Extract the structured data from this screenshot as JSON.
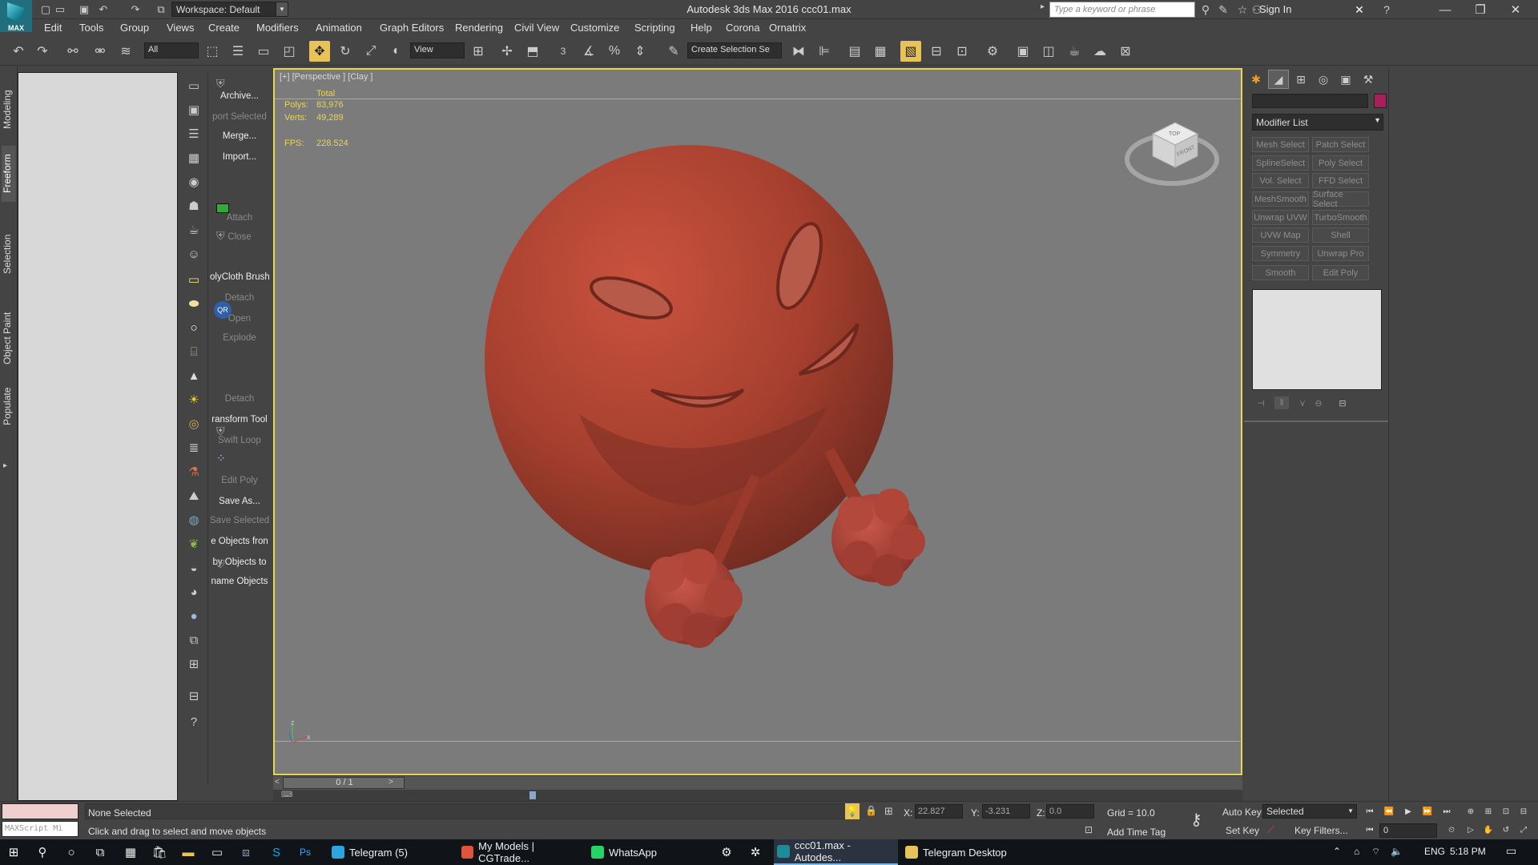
{
  "app": {
    "logo_text": "MAX",
    "title": "Autodesk 3ds Max 2016      ccc01.max",
    "workspace": "Workspace: Default",
    "search_placeholder": "Type a keyword or phrase",
    "signin": "Sign In"
  },
  "menu": [
    "Edit",
    "Tools",
    "Group",
    "Views",
    "Create",
    "Modifiers",
    "Animation",
    "Graph Editors",
    "Rendering",
    "Civil View",
    "Customize",
    "Scripting",
    "Help",
    "Corona",
    "Ornatrix"
  ],
  "toolbar": {
    "filter_select": "All",
    "ref_coord": "View",
    "selection_set": "Create Selection Se",
    "snap_label": "3"
  },
  "ribbon_tabs": [
    "Modeling",
    "Freeform",
    "Selection",
    "Object Paint",
    "Populate"
  ],
  "command_labels": [
    {
      "text": "Archive...",
      "dim": false
    },
    {
      "text": "port Selected",
      "dim": true
    },
    {
      "text": "Merge...",
      "dim": false
    },
    {
      "text": "Import...",
      "dim": false
    },
    {
      "text": "Attach",
      "dim": true
    },
    {
      "text": "Close",
      "dim": true
    },
    {
      "text": "olyCloth Brush",
      "dim": false
    },
    {
      "text": "Detach",
      "dim": true
    },
    {
      "text": "Open",
      "dim": true
    },
    {
      "text": "Explode",
      "dim": true
    },
    {
      "text": "Detach",
      "dim": true
    },
    {
      "text": "ransform Tool",
      "dim": false
    },
    {
      "text": "Swift Loop",
      "dim": true
    },
    {
      "text": "Edit Poly",
      "dim": true
    },
    {
      "text": "Save As...",
      "dim": false
    },
    {
      "text": "Save Selected",
      "dim": true
    },
    {
      "text": "e Objects fron",
      "dim": false
    },
    {
      "text": "by Objects to",
      "dim": false
    },
    {
      "text": "name Objects",
      "dim": false
    }
  ],
  "viewport": {
    "label": "[+] [Perspective ] [Clay ]",
    "stats_header": "Total",
    "polys_label": "Polys:",
    "polys": "83,976",
    "verts_label": "Verts:",
    "verts": "49,289",
    "fps_label": "FPS:",
    "fps": "228.524",
    "viewcube_top": "TOP",
    "viewcube_front": "FRONT",
    "axis_x": "x",
    "axis_z": "z"
  },
  "timeline": {
    "frame_label": "0 / 1"
  },
  "command_panel": {
    "modifier_list": "Modifier List",
    "modifiers": [
      "Mesh Select",
      "Patch Select",
      "SplineSelect",
      "Poly Select",
      "Vol. Select",
      "FFD Select",
      "MeshSmooth",
      "Surface Select",
      "Unwrap UVW",
      "TurboSmooth",
      "UVW Map",
      "Shell",
      "Symmetry",
      "Unwrap Pro",
      "Smooth",
      "Edit Poly"
    ],
    "color_swatch": "#a8205a"
  },
  "status": {
    "maxscript": "MAXScript Mi",
    "selection": "None Selected",
    "prompt": "Click and drag to select and move objects",
    "x_label": "X:",
    "x": "22.827",
    "y_label": "Y:",
    "y": "-3.231",
    "z_label": "Z:",
    "z": "0.0",
    "grid": "Grid = 10.0",
    "add_time_tag": "Add Time Tag",
    "auto_key": "Auto Key",
    "set_key": "Set Key",
    "selected": "Selected",
    "key_filters": "Key Filters...",
    "frame": "0"
  },
  "taskbar": {
    "apps": [
      {
        "label": "Telegram (5)",
        "color": "#2ca5e0",
        "active": false
      },
      {
        "label": "My Models | CGTrade...",
        "color": "#e0533c",
        "active": false
      },
      {
        "label": "WhatsApp",
        "color": "#25d366",
        "active": false
      },
      {
        "label": "ccc01.max - Autodes...",
        "color": "#1f8a9a",
        "active": true
      },
      {
        "label": "Telegram Desktop",
        "color": "#e8c35a",
        "active": false
      }
    ],
    "lang": "ENG",
    "time": "5:18 PM"
  }
}
